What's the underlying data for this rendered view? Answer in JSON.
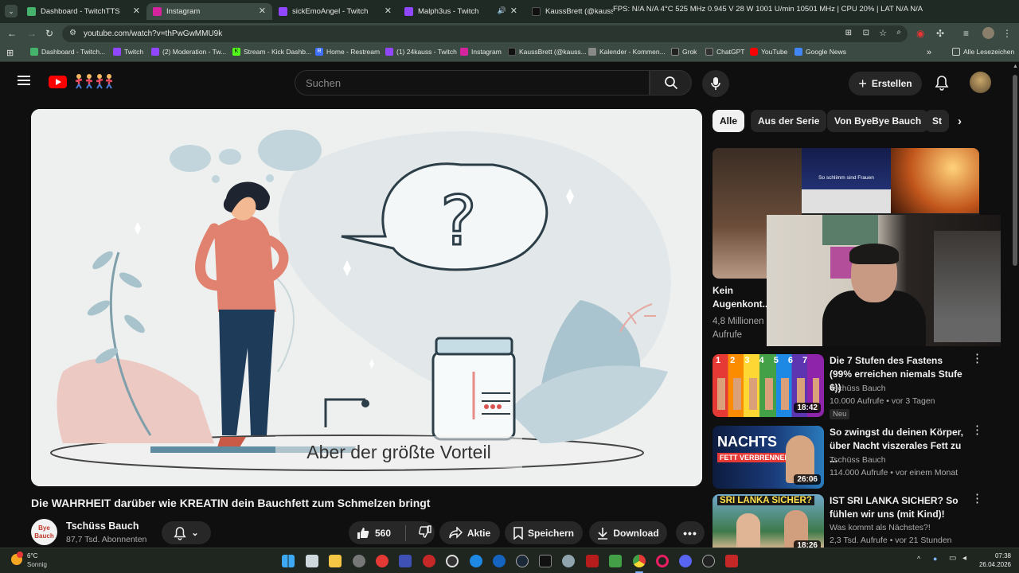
{
  "browser": {
    "tabs": [
      {
        "label": "Dashboard - TwitchTTS",
        "color": "#45b36b"
      },
      {
        "label": "Instagram",
        "color": "#d6249f"
      },
      {
        "label": "sickEmoAngel - Twitch",
        "color": "#9146ff"
      },
      {
        "label": "Malph3us - Twitch",
        "color": "#9146ff"
      },
      {
        "label": "KaussBrett (@kaussbrett) | TikTok",
        "color": "#111111"
      }
    ],
    "overlay_stats": "FPS: N/A  N/A   4°C  525 MHz  0.945 V  28 W  1001 U/min  10501 MHz  |  CPU 20%  |  LAT N/A  N/A",
    "url": "youtube.com/watch?v=thPwGwMMU9k",
    "bookmarks": [
      {
        "label": "Dashboard - Twitch...",
        "color": "#45b36b"
      },
      {
        "label": "Twitch",
        "color": "#9146ff"
      },
      {
        "label": "(2) Moderation - Tw...",
        "color": "#9146ff"
      },
      {
        "label": "Stream - Kick Dashb...",
        "color": "#53fc18"
      },
      {
        "label": "Home - Restream",
        "color": "#3f6fff"
      },
      {
        "label": "(1) 24kauss - Twitch",
        "color": "#9146ff"
      },
      {
        "label": "Instagram",
        "color": "#d6249f"
      },
      {
        "label": "KaussBrett (@kauss...",
        "color": "#111111"
      },
      {
        "label": "Kalender - Kommen...",
        "color": "#888888"
      },
      {
        "label": "Grok",
        "color": "#222222"
      },
      {
        "label": "ChatGPT",
        "color": "#333333"
      },
      {
        "label": "YouTube",
        "color": "#ff0000"
      },
      {
        "label": "Google News",
        "color": "#4285f4"
      }
    ],
    "all_bookmarks": "Alle Lesezeichen"
  },
  "youtube": {
    "search_placeholder": "Suchen",
    "create_label": "Erstellen",
    "subtitle": "Aber der größte Vorteil",
    "video_title": "Die WAHRHEIT darüber wie KREATIN dein Bauchfett zum Schmelzen bringt",
    "channel_name": "Tschüss Bauch",
    "subscribers": "87,7 Tsd. Abonnenten",
    "likes": "560",
    "share_label": "Aktie",
    "save_label": "Speichern",
    "download_label": "Download",
    "chips": [
      "Alle",
      "Aus der Serie",
      "Von ByeBye Bauch",
      "St"
    ],
    "top_rec": {
      "title": "Kein Augenkont...",
      "meta": "4,8 Millionen Aufrufe",
      "overlay_text": "So schlimm sind Frauen"
    },
    "recs": [
      {
        "title": "Die 7 Stufen des Fastens (99% erreichen niemals Stufe 6))",
        "channel": "Tschüss Bauch",
        "meta": "10.000 Aufrufe • vor 3 Tagen",
        "badge": "Neu",
        "duration": "18:42",
        "thumb_text": "1 2 3 4 5 6 7"
      },
      {
        "title": "So zwingst du deinen Körper, über Nacht viszerales Fett zu ...",
        "channel": "Tschüss Bauch",
        "meta": "114.000 Aufrufe • vor einem Monat",
        "duration": "26:06",
        "thumb_text": "NACHTS",
        "thumb_text2": "FETT VERBRENNEN"
      },
      {
        "title": "IST SRI LANKA SICHER? So fühlen wir uns (mit Kind)!",
        "channel": "Was kommt als Nächstes?!",
        "meta": "2,3 Tsd. Aufrufe • vor 21 Stunden",
        "duration": "18:26",
        "thumb_text": "SRI LANKA SICHER?"
      }
    ]
  },
  "taskbar": {
    "weather_temp": "6°C",
    "weather_text": "Sonnig",
    "time": "07:38",
    "date": "26.04.2026"
  }
}
